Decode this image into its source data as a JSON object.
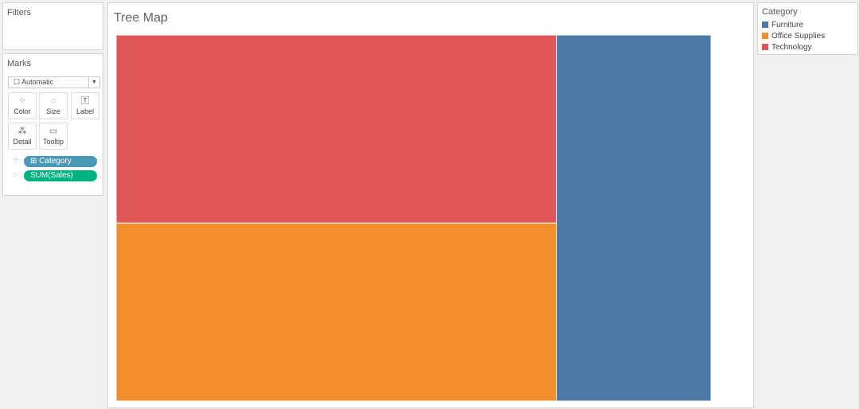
{
  "filters": {
    "title": "Filters"
  },
  "marks": {
    "title": "Marks",
    "mark_type": "Automatic",
    "cards": [
      "Color",
      "Size",
      "Label",
      "Detail",
      "Tooltip"
    ],
    "pills": [
      {
        "label": "⊞ Category",
        "color": "#4a98b5"
      },
      {
        "label": "SUM(Sales)",
        "color": "#00b180"
      }
    ]
  },
  "legend": {
    "title": "Category"
  },
  "chart_data": {
    "type": "treemap",
    "title": "Tree Map",
    "size_measure": "SUM(Sales)",
    "color_dimension": "Category",
    "categories": [
      "Furniture",
      "Office Supplies",
      "Technology"
    ],
    "values_share": [
      0.26,
      0.36,
      0.38
    ],
    "colors": [
      "#4e79a7",
      "#f28e2b",
      "#e15759"
    ]
  }
}
